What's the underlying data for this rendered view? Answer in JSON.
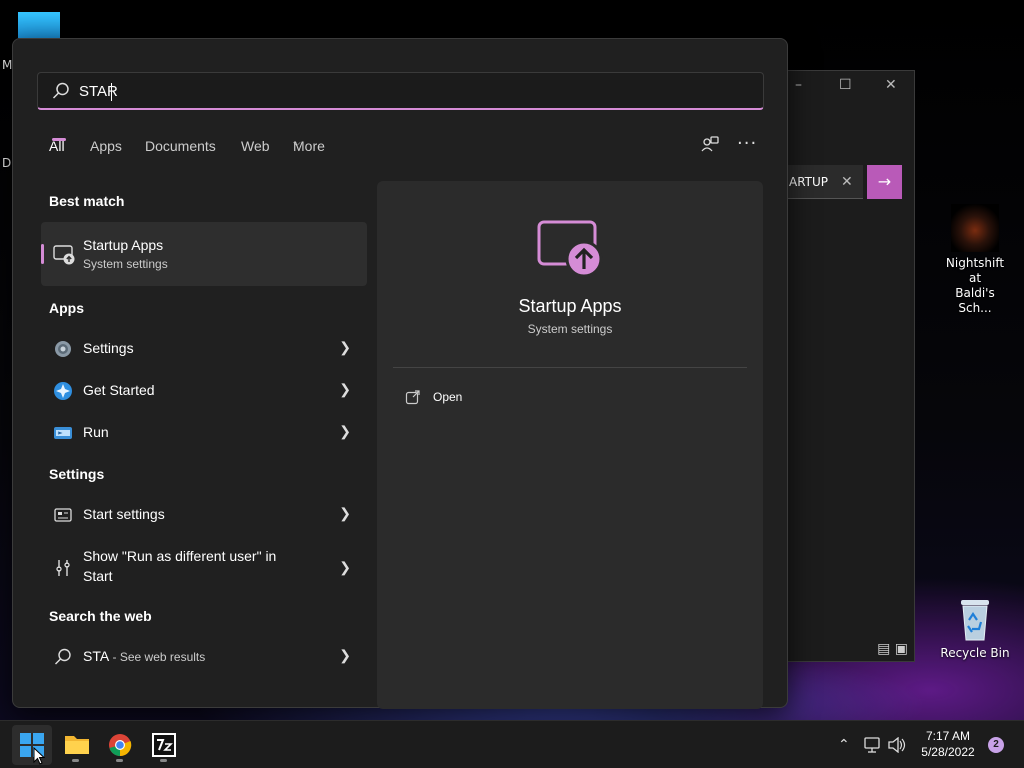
{
  "desktop": {
    "partial_label_1": "M",
    "partial_label_2": "D",
    "icons": [
      {
        "label": "Nightshift at Baldi's Sch...",
        "label_line1": "Nightshift at",
        "label_line2": "Baldi's Sch..."
      },
      {
        "label": "Recycle Bin"
      }
    ]
  },
  "background_window": {
    "search_text": "ARTUP",
    "clear_icon": "close-icon",
    "go_icon": "arrow-right-icon"
  },
  "search": {
    "query": "STAR",
    "placeholder": ""
  },
  "filters": {
    "tabs": [
      "All",
      "Apps",
      "Documents",
      "Web",
      "More"
    ],
    "active": "All"
  },
  "best_match": {
    "heading": "Best match",
    "name": "Startup Apps",
    "subtitle": "System settings"
  },
  "apps": {
    "heading": "Apps",
    "items": [
      {
        "label": "Settings",
        "icon": "gear-icon"
      },
      {
        "label": "Get Started",
        "icon": "get-started-icon"
      },
      {
        "label": "Run",
        "icon": "run-icon"
      }
    ]
  },
  "settings": {
    "heading": "Settings",
    "items": [
      {
        "label": "Start settings",
        "icon": "start-settings-icon"
      },
      {
        "label_line1": "Show \"Run as different user\" in",
        "label_line2": "Start",
        "icon": "run-as-user-icon"
      }
    ]
  },
  "web": {
    "heading": "Search the web",
    "query": "STA",
    "suffix": " - See web results"
  },
  "detail": {
    "title": "Startup Apps",
    "subtitle": "System settings",
    "action_open": "Open"
  },
  "taskbar": {
    "apps": [
      "start-icon",
      "file-explorer-icon",
      "chrome-icon",
      "7zip-icon"
    ],
    "time": "7:17 AM",
    "date": "5/28/2022",
    "notification_count": "2"
  },
  "colors": {
    "accent": "#d58cd6",
    "panel": "#202020",
    "detail_pane": "#2b2b2b"
  }
}
